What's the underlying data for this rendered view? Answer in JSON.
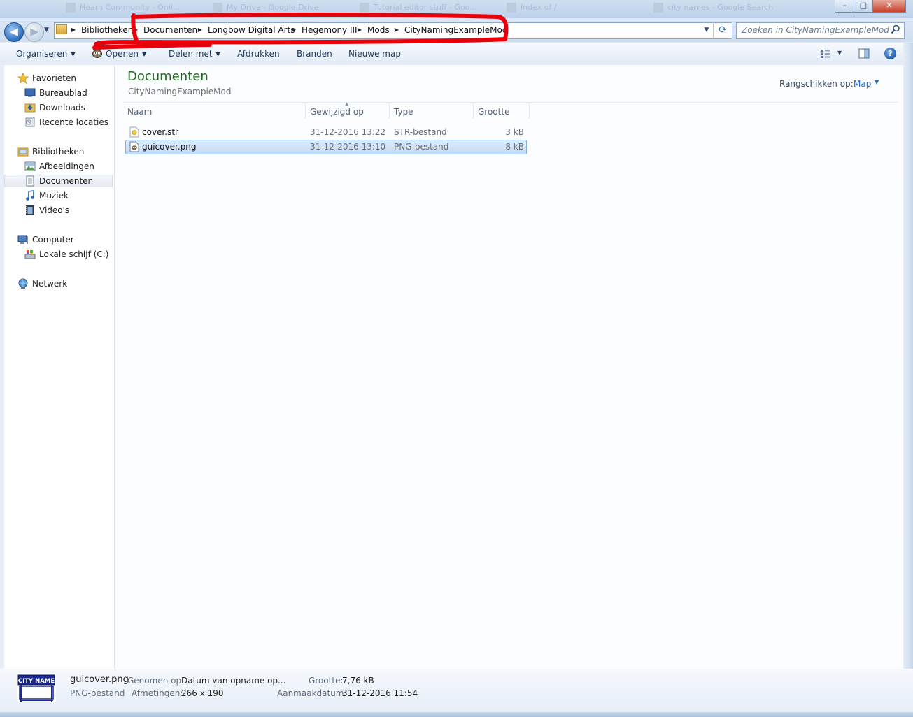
{
  "titlebar": {
    "tabs": [
      "Hearn Community - Onli...",
      "My Drive - Google Drive",
      "Tutorial editor stuff - Goo...",
      "Index of /",
      "city names - Google Search"
    ],
    "minimize": "–",
    "maximize": "□",
    "close": "✕"
  },
  "navigation": {
    "back": "◀",
    "forward": "▶",
    "breadcrumbs": [
      "Bibliotheken",
      "Documenten",
      "Longbow Digital Arts",
      "Hegemony III",
      "Mods",
      "CityNamingExampleMod"
    ],
    "search_placeholder": "Zoeken in CityNamingExampleMod"
  },
  "annotation": {
    "color": "#e8000b"
  },
  "toolbar": {
    "organize": "Organiseren",
    "open": "Openen",
    "share": "Delen met",
    "print": "Afdrukken",
    "burn": "Branden",
    "new_folder": "Nieuwe map"
  },
  "navpane": {
    "favorites": {
      "header": "Favorieten",
      "items": [
        "Bureaublad",
        "Downloads",
        "Recente locaties"
      ]
    },
    "libraries": {
      "header": "Bibliotheken",
      "items": [
        "Afbeeldingen",
        "Documenten",
        "Muziek",
        "Video's"
      ],
      "selected": "Documenten"
    },
    "computer": {
      "header": "Computer",
      "items": [
        "Lokale schijf (C:)"
      ]
    },
    "network": {
      "header": "Netwerk"
    }
  },
  "library_header": {
    "title": "Documenten",
    "subtitle": "CityNamingExampleMod",
    "arrange_label": "Rangschikken op:",
    "arrange_value": "Map"
  },
  "columns": [
    "Naam",
    "Gewijzigd op",
    "Type",
    "Grootte"
  ],
  "files": [
    {
      "name": "cover.str",
      "modified": "31-12-2016 13:22",
      "type": "STR-bestand",
      "size": "3 kB",
      "selected": false
    },
    {
      "name": "guicover.png",
      "modified": "31-12-2016 13:10",
      "type": "PNG-bestand",
      "size": "8 kB",
      "selected": true
    }
  ],
  "details": {
    "thumb_text": "CITY NAME",
    "filename": "guicover.png",
    "filetype": "PNG-bestand",
    "taken_label": "Genomen op:",
    "taken_value": "Datum van opname op...",
    "dims_label": "Afmetingen:",
    "dims_value": "266 x 190",
    "size_label": "Grootte:",
    "size_value": "7,76 kB",
    "created_label": "Aanmaakdatum:",
    "created_value": "31-12-2016 11:54"
  }
}
